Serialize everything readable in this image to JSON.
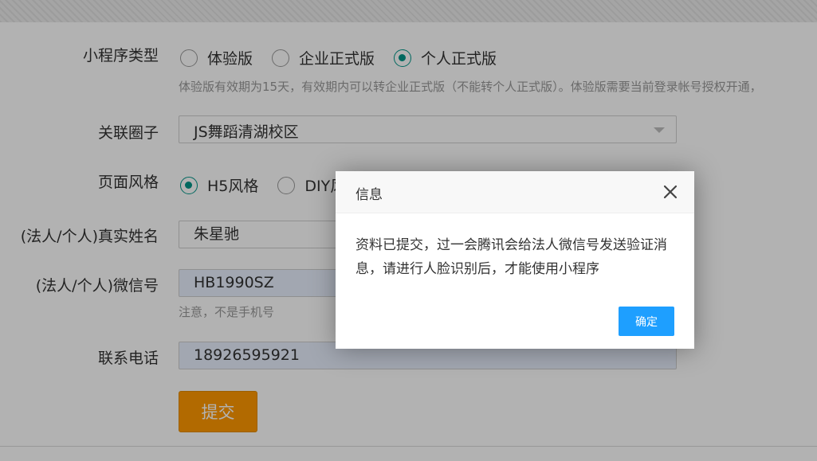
{
  "form": {
    "type_label": "小程序类型",
    "type_options": [
      "体验版",
      "企业正式版",
      "个人正式版"
    ],
    "type_selected": "个人正式版",
    "type_hint": "体验版有效期为15天，有效期内可以转企业正式版（不能转个人正式版）。体验版需要当前登录帐号授权开通，",
    "circle_label": "关联圈子",
    "circle_value": "JS舞蹈清湖校区",
    "style_label": "页面风格",
    "style_options": [
      "H5风格",
      "DIY风"
    ],
    "style_selected": "H5风格",
    "name_label": "(法人/个人)真实姓名",
    "name_value": "朱星驰",
    "wechat_label": "(法人/个人)微信号",
    "wechat_value": "HB1990SZ",
    "wechat_hint": "注意，不是手机号",
    "phone_label": "联系电话",
    "phone_value": "18926595921",
    "submit_label": "提交"
  },
  "dialog": {
    "title": "信息",
    "message": "资料已提交，过一会腾讯会给法人微信号发送验证消息，请进行人脸识别后，才能使用小程序",
    "ok_label": "确定"
  },
  "colors": {
    "accent_green": "#009688",
    "submit_orange": "#ff9900",
    "dialog_button_blue": "#1e9fff",
    "autofill_bg": "#e8f0fe"
  },
  "icons": {
    "close": "close-icon",
    "dropdown": "caret-down-icon"
  }
}
